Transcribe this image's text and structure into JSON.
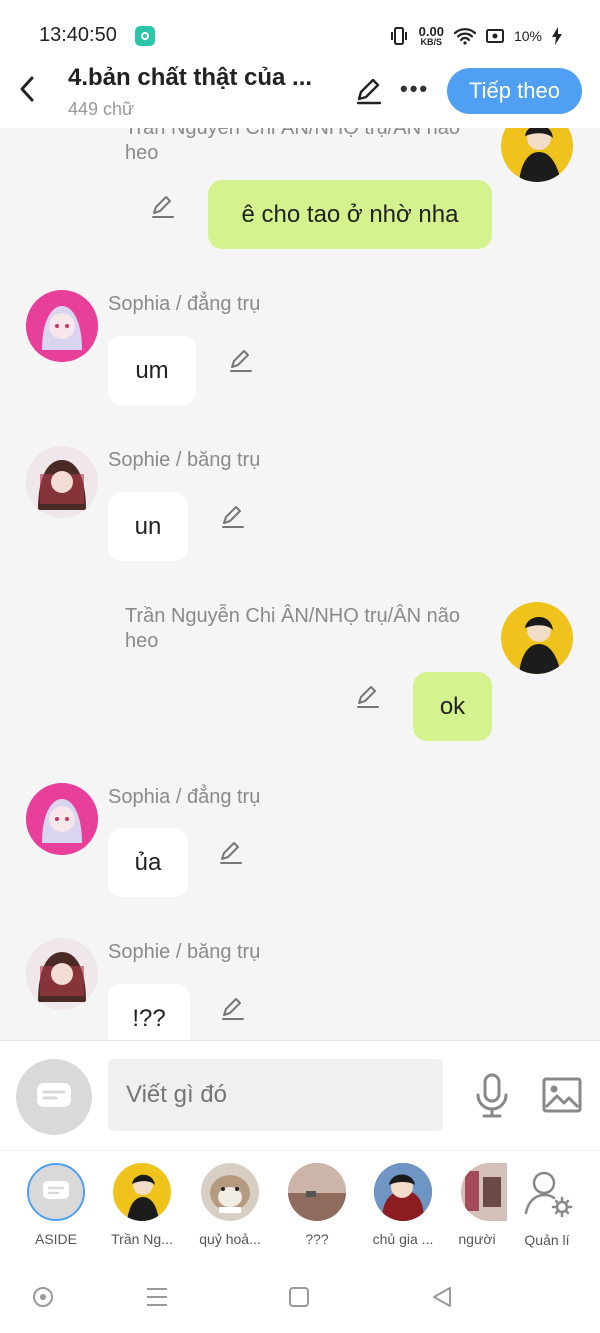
{
  "status_bar": {
    "time": "13:40:50",
    "net_speed_value": "0.00",
    "net_speed_unit": "KB/S",
    "battery": "10%"
  },
  "header": {
    "title": "4.bản chất thật của ...",
    "word_count": "449 chữ",
    "next_label": "Tiếp theo"
  },
  "messages": [
    {
      "sender": "Trần Nguyễn Chi ÂN/NHỌ trụ/ÂN não heo",
      "text": "ê cho tao ở nhờ nha",
      "side": "right"
    },
    {
      "sender": "Sophia / đẳng trụ",
      "text": "um",
      "side": "left"
    },
    {
      "sender": "Sophie / băng trụ",
      "text": "un",
      "side": "left"
    },
    {
      "sender_line1": "Trần Nguyễn Chi ÂN/NHỌ trụ/ÂN não",
      "sender_line2": "heo",
      "text": "ok",
      "side": "right"
    },
    {
      "sender": "Sophia / đẳng trụ",
      "text": "ủa",
      "side": "left"
    },
    {
      "sender": "Sophie / băng trụ",
      "text": "!??",
      "side": "left"
    }
  ],
  "composer": {
    "placeholder": "Viết gì đó"
  },
  "characters": [
    {
      "label": "ASIDE"
    },
    {
      "label": "Trần Ng..."
    },
    {
      "label": "quỷ hoả..."
    },
    {
      "label": "???"
    },
    {
      "label": "chủ gia ..."
    },
    {
      "label": "người"
    },
    {
      "label": "Quản lí"
    }
  ],
  "colors": {
    "accent": "#4f9ff2",
    "my_bubble": "#d4f28e",
    "background": "#f5f5f5"
  }
}
